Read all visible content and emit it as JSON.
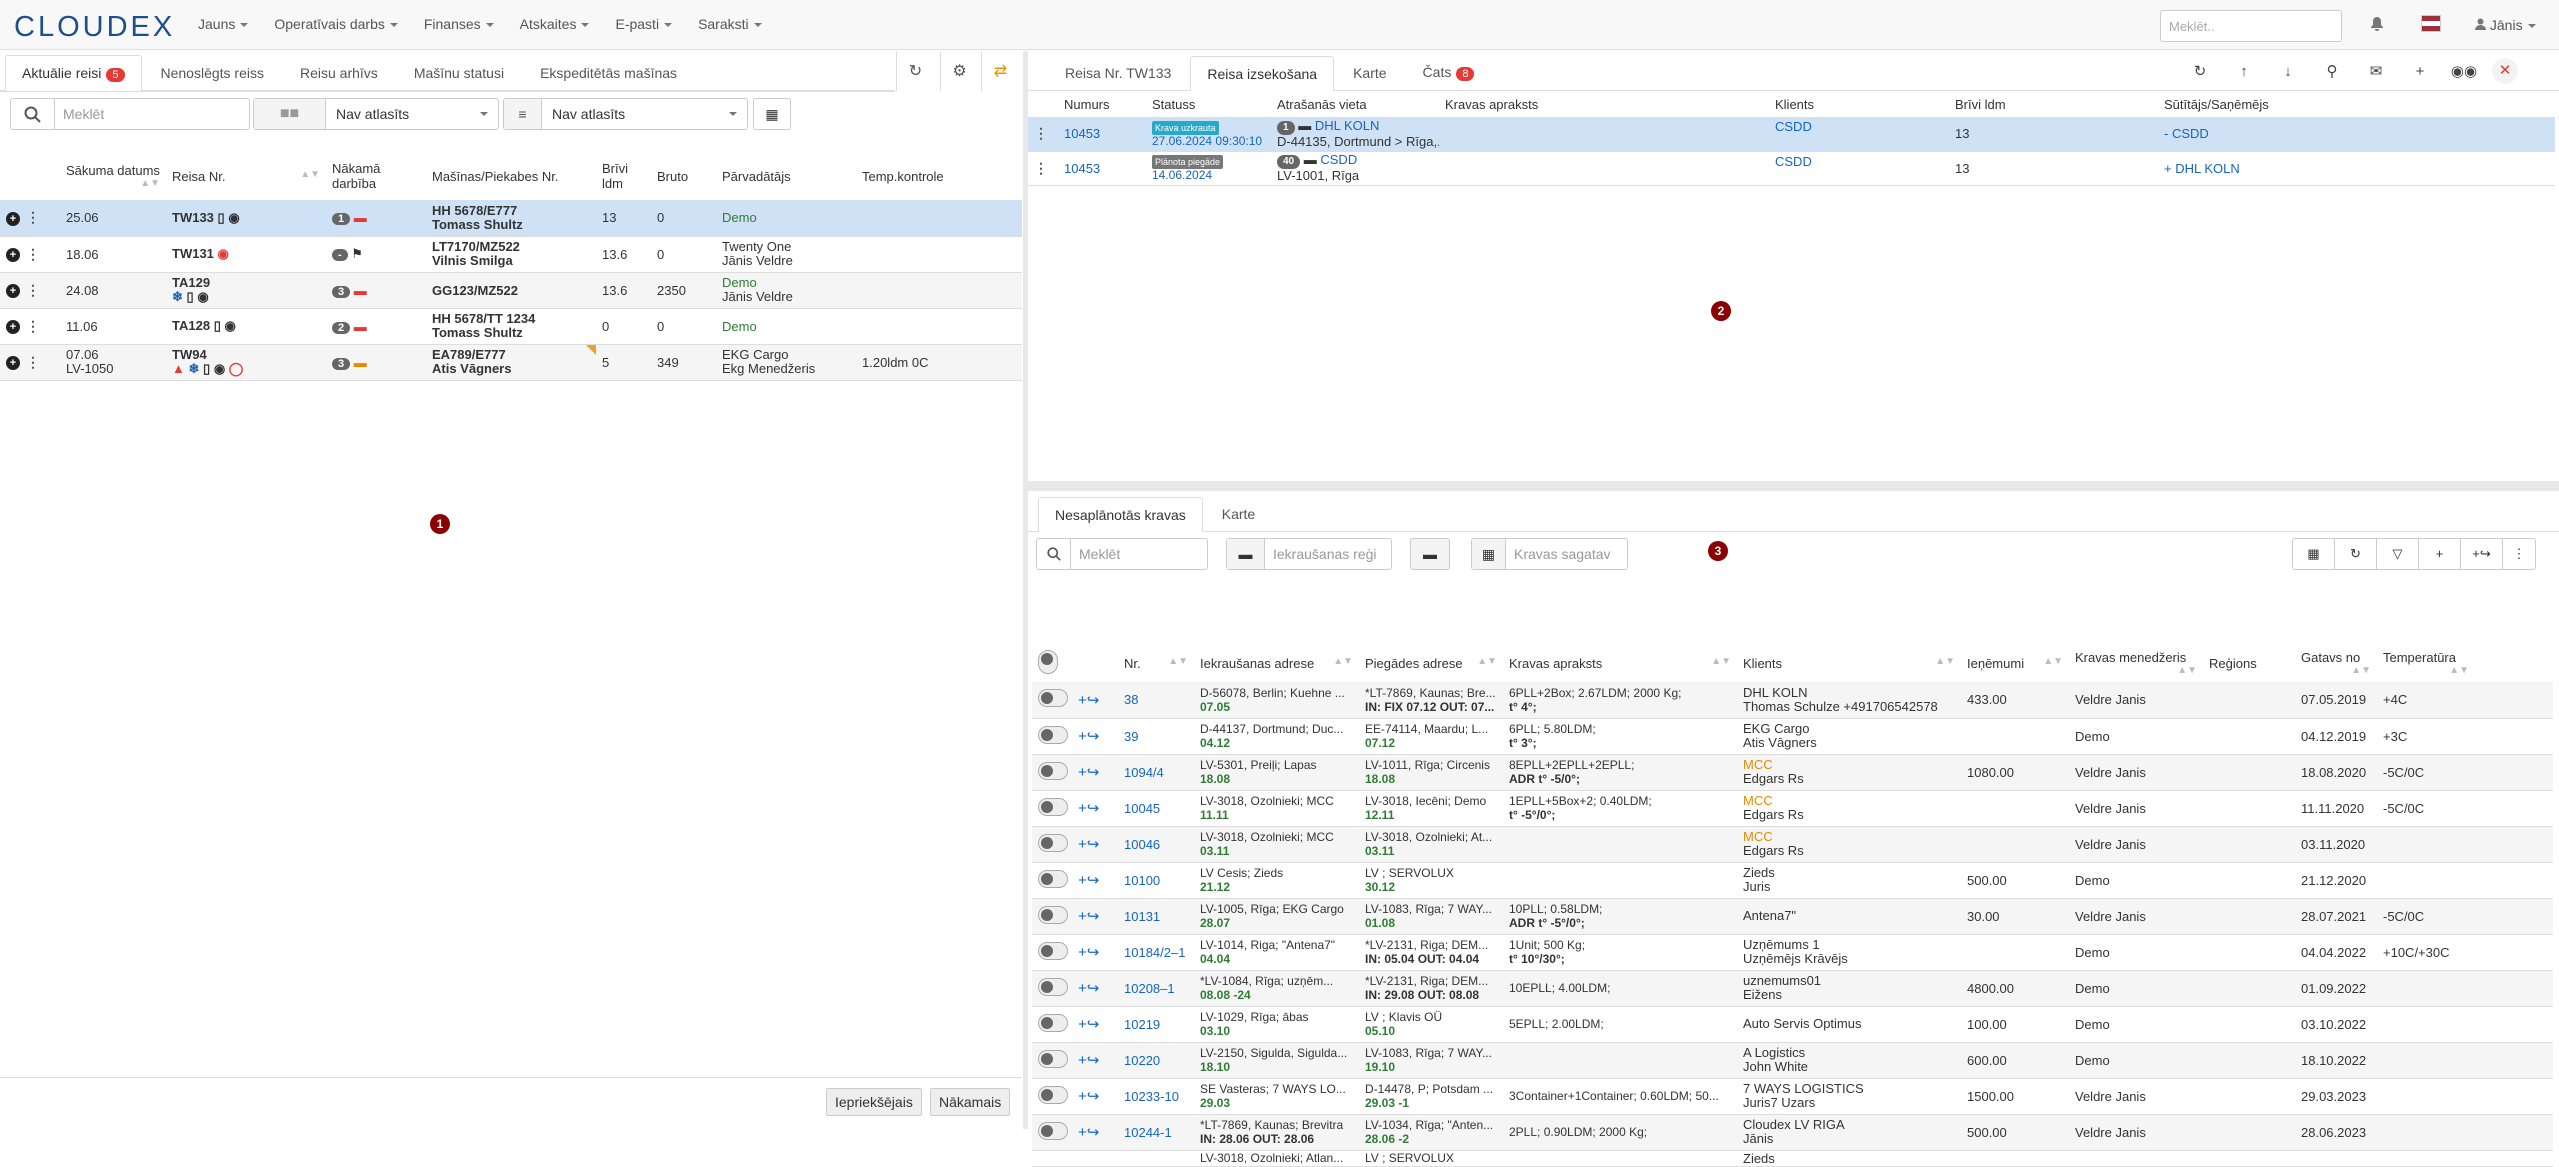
{
  "app": {
    "logo": "CLOUDEX",
    "search_placeholder": "Meklēt..",
    "user": "Jānis"
  },
  "menu": [
    "Jauns",
    "Operatīvais darbs",
    "Finanses",
    "Atskaites",
    "E-pasti",
    "Saraksti"
  ],
  "left": {
    "tabs": [
      "Aktuālie reisi",
      "Nenoslēgts reiss",
      "Reisu arhīvs",
      "Mašīnu statusi",
      "Ekspeditētās mašīnas"
    ],
    "tab_badge": "5",
    "search_placeholder": "Meklēt",
    "filter1": "Nav atlasīts",
    "filter2": "Nav atlasīts",
    "columns": [
      "Sākuma datums",
      "Reisa Nr.",
      "Nākamā darbība",
      "Mašīnas/Piekabes Nr.",
      "Brīvi ldm",
      "Bruto",
      "Pārvadātājs",
      "Temp.kontrole"
    ],
    "rows": [
      {
        "date": "25.06",
        "date2": "",
        "trip": "TW133",
        "next": "1",
        "truck": "HH 5678/E777",
        "driver": "Tomass Shultz",
        "ldm": "13",
        "bruto": "0",
        "carrier": "Demo",
        "carrier2": "",
        "temp": ""
      },
      {
        "date": "18.06",
        "date2": "",
        "trip": "TW131",
        "next": "-",
        "truck": "LT7170/MZ522",
        "driver": "Vilnis Smilga",
        "ldm": "13.6",
        "bruto": "0",
        "carrier": "Twenty One",
        "carrier2": "Jānis Veldre",
        "temp": ""
      },
      {
        "date": "24.08",
        "date2": "",
        "trip": "TA129",
        "next": "3",
        "truck": "GG123/MZ522",
        "driver": "",
        "ldm": "13.6",
        "bruto": "2350",
        "carrier": "Demo",
        "carrier2": "Jānis Veldre",
        "temp": ""
      },
      {
        "date": "11.06",
        "date2": "",
        "trip": "TA128",
        "next": "2",
        "truck": "HH 5678/TT 1234",
        "driver": "Tomass Shultz",
        "ldm": "0",
        "bruto": "0",
        "carrier": "Demo",
        "carrier2": "",
        "temp": ""
      },
      {
        "date": "07.06",
        "date2": "LV-1050",
        "trip": "TW94",
        "next": "3",
        "truck": "EA789/E777",
        "driver": "Atis Vāgners",
        "ldm": "5",
        "bruto": "349",
        "carrier": "EKG Cargo",
        "carrier2": "Ekg Menedžeris",
        "temp": "1.20ldm 0C"
      }
    ],
    "prev_btn": "Iepriekšējais",
    "next_btn": "Nākamais",
    "marker": "1"
  },
  "right": {
    "tabs": [
      "Reisa Nr. TW133",
      "Reisa izsekošana",
      "Karte",
      "Čats"
    ],
    "chat_badge": "8",
    "columns": [
      "Numurs",
      "Statuss",
      "Atrašanās vieta",
      "Kravas apraksts",
      "Klients",
      "Brīvi ldm",
      "Sūtītājs/Saņēmējs"
    ],
    "rows": [
      {
        "num": "10453",
        "status": "Krava uzkrauta",
        "status_color": "#29a9c9",
        "time": "27.06.2024 09:30:10",
        "loc_n": "1",
        "loc_name": "DHL KOLN",
        "loc_addr": "D-44135, Dortmund > Rīga,...",
        "client": "CSDD",
        "ldm": "13",
        "sr": "- CSDD"
      },
      {
        "num": "10453",
        "status": "Plānota piegāde",
        "status_color": "#777",
        "time": "14.06.2024",
        "loc_n": "40",
        "loc_name": "CSDD",
        "loc_addr": "LV-1001, Rīga",
        "client": "CSDD",
        "ldm": "13",
        "sr": "+ DHL KOLN"
      }
    ],
    "marker": "2"
  },
  "bottom": {
    "tabs": [
      "Nesaplānotās kravas",
      "Karte"
    ],
    "search_placeholder": "Meklēt",
    "region_placeholder": "Iekraušanas reģi",
    "ready_placeholder": "Kravas sagatav",
    "marker": "3",
    "columns": [
      "Nr.",
      "Iekraušanas adrese",
      "Piegādes adrese",
      "Kravas apraksts",
      "Klients",
      "Ieņēmumi",
      "Kravas menedžeris",
      "Reģions",
      "Gatavs no",
      "Temperatūra"
    ],
    "rows": [
      {
        "nr": "38",
        "l1": "D-56078, Berlin; Kuehne ...",
        "l2": "07.05",
        "d1": "*LT-7869, Kaunas; Bre...",
        "d2": "IN: FIX 07.12 OUT: 07...",
        "c1": "6PLL+2Box; 2.67LDM; 2000 Kg;",
        "c2": "t° 4°;",
        "k1": "DHL KOLN",
        "k2": "Thomas Schulze +491706542578",
        "inc": "433.00",
        "mgr": "Veldre Janis",
        "reg": "",
        "ready": "07.05.2019",
        "temp": "+4C"
      },
      {
        "nr": "39",
        "l1": "D-44137, Dortmund; Duc...",
        "l2": "04.12",
        "d1": "EE-74114, Maardu; L...",
        "d2": "07.12",
        "c1": "6PLL; 5.80LDM;",
        "c2": "t° 3°;",
        "k1": "EKG Cargo",
        "k2": "Atis Vāgners",
        "inc": "",
        "mgr": "Demo",
        "reg": "",
        "ready": "04.12.2019",
        "temp": "+3C"
      },
      {
        "nr": "1094/4",
        "l1": "LV-5301, Preiļi; Lapas",
        "l2": "18.08",
        "d1": "LV-1011, Rīga; Circenis",
        "d2": "18.08",
        "c1": "8EPLL+2EPLL+2EPLL;",
        "c2": "ADR t° -5/0°;",
        "k1": "MCC",
        "k2": "Edgars Rs",
        "inc": "1080.00",
        "mgr": "Veldre Janis",
        "reg": "",
        "ready": "18.08.2020",
        "temp": "-5C/0C"
      },
      {
        "nr": "10045",
        "l1": "LV-3018, Ozolnieki; MCC",
        "l2": "11.11",
        "d1": "LV-3018, Iecēni; Demo",
        "d2": "12.11",
        "c1": "1EPLL+5Box+2; 0.40LDM;",
        "c2": "t° -5°/0°;",
        "k1": "MCC",
        "k2": "Edgars Rs",
        "inc": "",
        "mgr": "Veldre Janis",
        "reg": "",
        "ready": "11.11.2020",
        "temp": "-5C/0C"
      },
      {
        "nr": "10046",
        "l1": "LV-3018, Ozolnieki; MCC",
        "l2": "03.11",
        "d1": "LV-3018, Ozolnieki; At...",
        "d2": "03.11",
        "c1": "",
        "c2": "",
        "k1": "MCC",
        "k2": "Edgars Rs",
        "inc": "",
        "mgr": "Veldre Janis",
        "reg": "",
        "ready": "03.11.2020",
        "temp": ""
      },
      {
        "nr": "10100",
        "l1": "LV Cesis; Zieds",
        "l2": "21.12",
        "d1": "LV ; SERVOLUX",
        "d2": "30.12",
        "c1": "",
        "c2": "",
        "k1": "Zieds",
        "k2": "Juris",
        "inc": "500.00",
        "mgr": "Demo",
        "reg": "",
        "ready": "21.12.2020",
        "temp": ""
      },
      {
        "nr": "10131",
        "l1": "LV-1005, Rīga; EKG Cargo",
        "l2": "28.07",
        "d1": "LV-1083, Rīga; 7 WAY...",
        "d2": "01.08",
        "c1": "10PLL; 0.58LDM;",
        "c2": "ADR t° -5°/0°;",
        "k1": "Antena7\"",
        "k2": "",
        "inc": "30.00",
        "mgr": "Veldre Janis",
        "reg": "",
        "ready": "28.07.2021",
        "temp": "-5C/0C"
      },
      {
        "nr": "10184/2–1",
        "l1": "LV-1014, Riga; \"Antena7\"",
        "l2": "04.04",
        "d1": "*LV-2131, Riga; DEM...",
        "d2": "IN: 05.04 OUT: 04.04",
        "c1": "1Unit; 500 Kg;",
        "c2": "t° 10°/30°;",
        "k1": "Uzņēmums 1",
        "k2": "Uzņēmējs Krāvējs",
        "inc": "",
        "mgr": "Demo",
        "reg": "",
        "ready": "04.04.2022",
        "temp": "+10C/+30C"
      },
      {
        "nr": "10208–1",
        "l1": "*LV-1084, Rīga; uzņēm...",
        "l2": "08.08 -24",
        "d1": "*LV-2131, Riga; DEM...",
        "d2": "IN: 29.08 OUT: 08.08",
        "c1": "10EPLL; 4.00LDM;",
        "c2": "",
        "k1": "uznemums01",
        "k2": "Eižens",
        "inc": "4800.00",
        "mgr": "Demo",
        "reg": "",
        "ready": "01.09.2022",
        "temp": ""
      },
      {
        "nr": "10219",
        "l1": "LV-1029, Rīga; ābas",
        "l2": "03.10",
        "d1": "LV ; Klavis OÜ",
        "d2": "05.10",
        "c1": "5EPLL; 2.00LDM;",
        "c2": "",
        "k1": "Auto Servis Optimus",
        "k2": "",
        "inc": "100.00",
        "mgr": "Demo",
        "reg": "",
        "ready": "03.10.2022",
        "temp": ""
      },
      {
        "nr": "10220",
        "l1": "LV-2150, Sigulda, Sigulda...",
        "l2": "18.10",
        "d1": "LV-1083, Rīga; 7 WAY...",
        "d2": "19.10",
        "c1": "",
        "c2": "",
        "k1": "A Logistics",
        "k2": "John White",
        "inc": "600.00",
        "mgr": "Demo",
        "reg": "",
        "ready": "18.10.2022",
        "temp": ""
      },
      {
        "nr": "10233-10",
        "l1": "SE Vasteras; 7 WAYS LO...",
        "l2": "29.03",
        "d1": "D-14478, P; Potsdam ...",
        "d2": "29.03 -1",
        "c1": "3Container+1Container; 0.60LDM; 50...",
        "c2": "",
        "k1": "7 WAYS LOGISTICS",
        "k2": "Juris7 Uzars",
        "inc": "1500.00",
        "mgr": "Veldre Janis",
        "reg": "",
        "ready": "29.03.2023",
        "temp": ""
      },
      {
        "nr": "10244-1",
        "l1": "*LT-7869, Kaunas; Brevitra",
        "l2": "IN: 28.06 OUT: 28.06",
        "d1": "LV-1034, Rīga; \"Anten...",
        "d2": "28.06 -2",
        "c1": "2PLL; 0.90LDM; 2000 Kg;",
        "c2": "",
        "k1": "Cloudex LV RIGA",
        "k2": "Jānis",
        "inc": "500.00",
        "mgr": "Veldre Janis",
        "reg": "",
        "ready": "28.06.2023",
        "temp": ""
      }
    ],
    "partial_row": {
      "l1": "LV-3018, Ozolnieki; Atlan...",
      "d1": "LV ; SERVOLUX",
      "k1": "Zieds"
    }
  }
}
